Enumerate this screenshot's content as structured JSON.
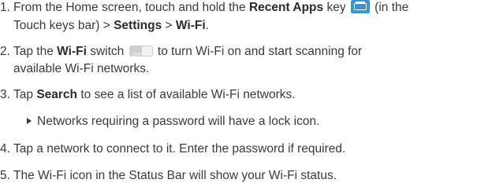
{
  "steps": [
    {
      "number": "1.",
      "line1_pre": "From the Home screen, touch and hold the ",
      "line1_bold1": "Recent Apps",
      "line1_mid": " key ",
      "line1_post": " (in the",
      "line2_pre": "Touch keys bar) > ",
      "line2_bold1": "Settings",
      "line2_sep": " > ",
      "line2_bold2": "Wi-Fi",
      "line2_end": "."
    },
    {
      "number": "2.",
      "line1_pre": "Tap the ",
      "line1_bold1": "Wi-Fi",
      "line1_mid": " switch ",
      "line1_post": " to turn Wi-Fi on and start scanning for",
      "line2": "available Wi-Fi networks."
    },
    {
      "number": "3.",
      "line1_pre": "Tap ",
      "line1_bold1": "Search",
      "line1_post": " to see a list of available Wi-Fi networks."
    },
    {
      "bullet": "Networks requiring a password will have a lock icon."
    },
    {
      "number": "4.",
      "text": "Tap a network to connect to it. Enter the password if required."
    },
    {
      "number": "5.",
      "text": "The Wi-Fi icon in the Status Bar will show your Wi-Fi status."
    }
  ],
  "icons": {
    "recent_apps": "recent-apps-key-icon",
    "wifi_switch": "wifi-switch-icon",
    "wifi_switch_label": "OFF",
    "accent": "#3a93d6"
  }
}
